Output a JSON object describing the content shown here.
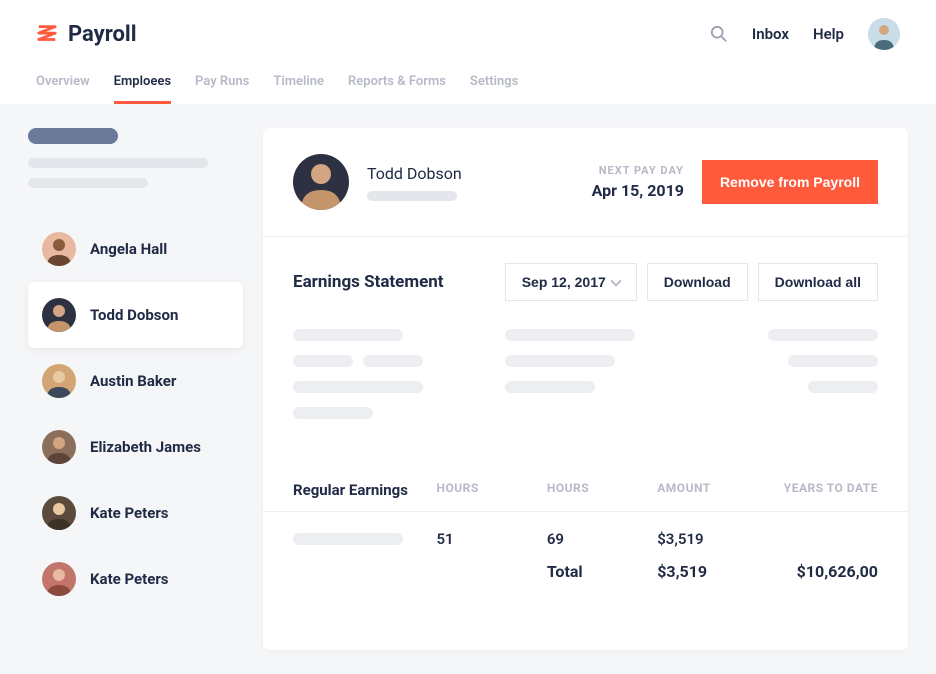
{
  "app": {
    "title": "Payroll"
  },
  "nav": {
    "inbox": "Inbox",
    "help": "Help"
  },
  "tabs": [
    {
      "label": "Overview"
    },
    {
      "label": "Emploees"
    },
    {
      "label": "Pay Runs"
    },
    {
      "label": "Timeline"
    },
    {
      "label": "Reports & Forms"
    },
    {
      "label": "Settings"
    }
  ],
  "active_tab": 1,
  "employees": [
    {
      "name": "Angela Hall",
      "bg": "#e8b8a0"
    },
    {
      "name": "Todd Dobson",
      "bg": "#2d3142"
    },
    {
      "name": "Austin Baker",
      "bg": "#d4a574"
    },
    {
      "name": "Elizabeth James",
      "bg": "#8b6f5c"
    },
    {
      "name": "Kate Peters",
      "bg": "#5c4a3d"
    },
    {
      "name": "Kate Peters",
      "bg": "#c4756b"
    }
  ],
  "selected_employee": 1,
  "detail": {
    "name": "Todd Dobson",
    "next_pay_label": "NEXT PAY DAY",
    "next_pay_date": "Apr 15, 2019",
    "remove_btn": "Remove from Payroll"
  },
  "statement": {
    "title": "Earnings Statement",
    "date_select": "Sep 12, 2017",
    "download": "Download",
    "download_all": "Download all"
  },
  "earnings": {
    "section_title": "Regular Earnings",
    "cols": {
      "h1": "HOURS",
      "h2": "HOURS",
      "amt": "AMOUNT",
      "ytd": "YEARS TO DATE"
    },
    "row": {
      "hours1": "51",
      "hours2": "69",
      "amount": "$3,519"
    },
    "total": {
      "label": "Total",
      "amount": "$3,519",
      "ytd": "$10,626,00"
    }
  }
}
